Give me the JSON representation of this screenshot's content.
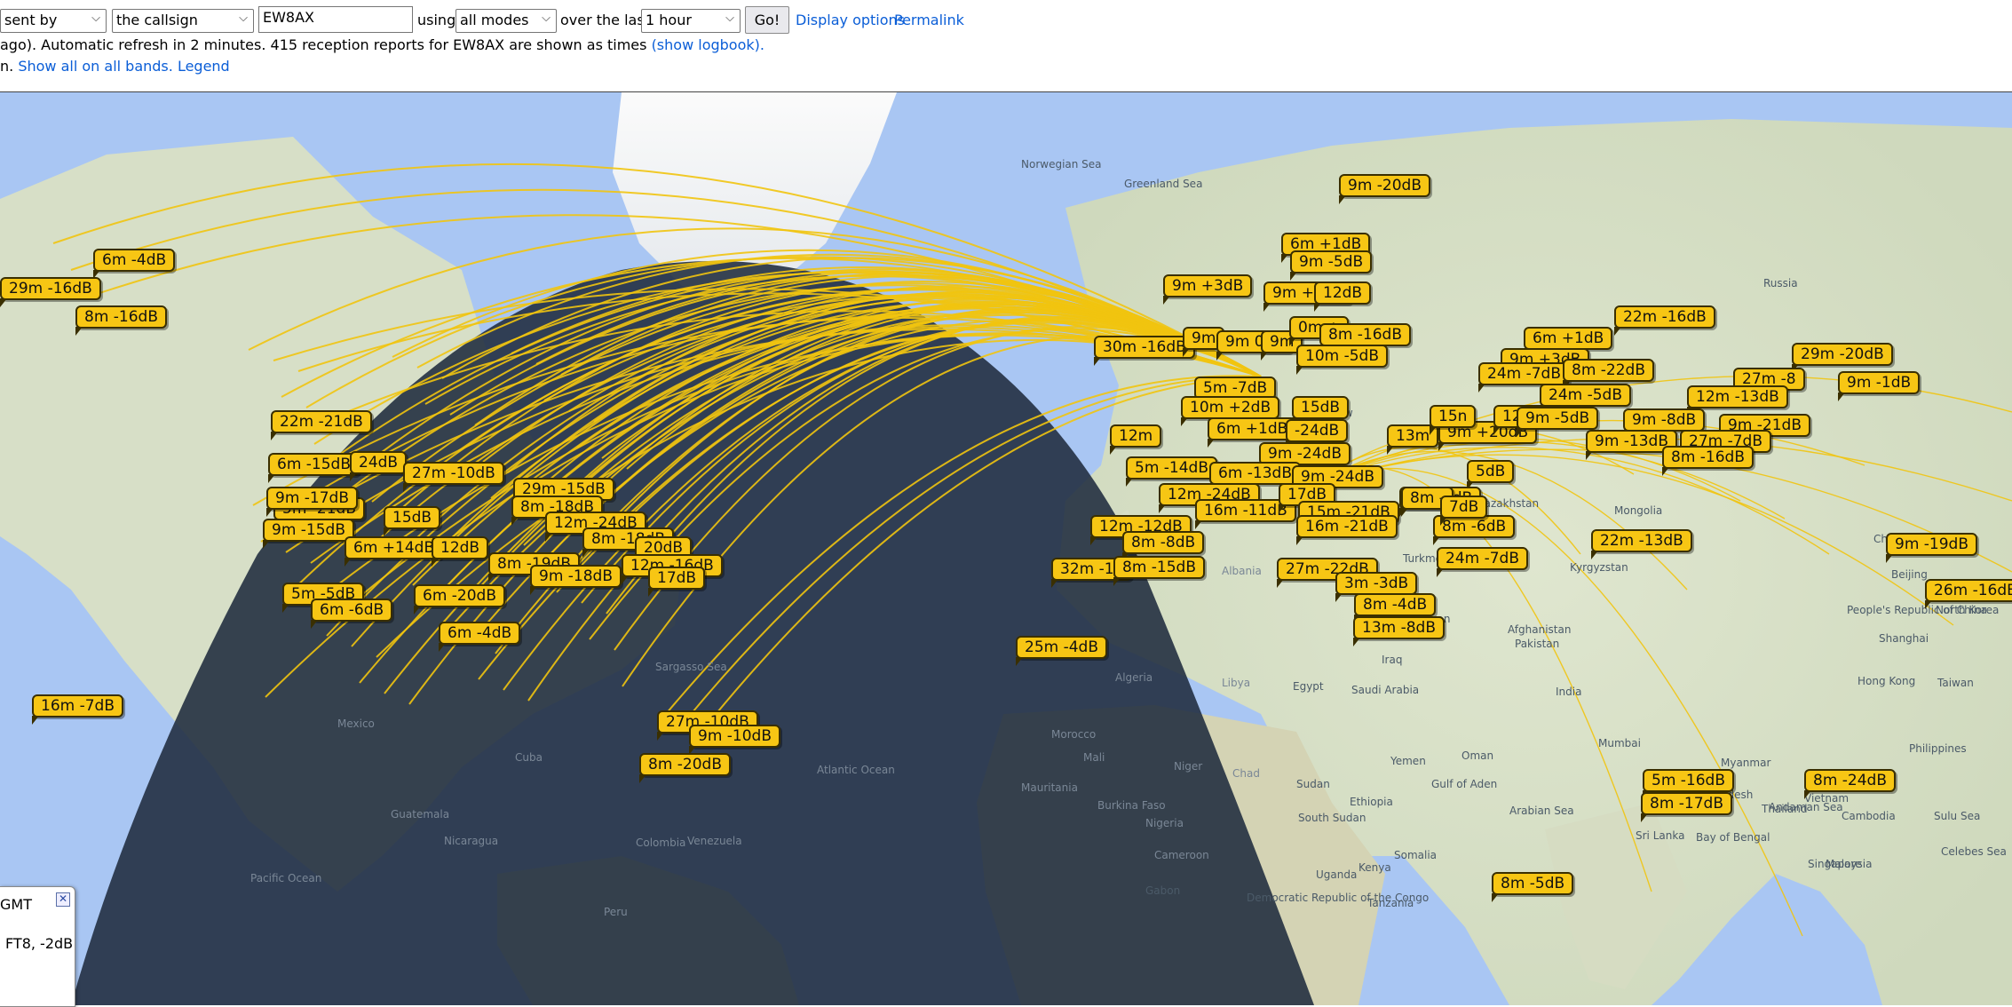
{
  "controls": {
    "sent_by": "sent by",
    "callsign_mode": "the callsign",
    "callsign_value": "EW8AX",
    "using_text": "using",
    "modes": "all modes",
    "over_text": "over the last",
    "period": "1 hour",
    "go_label": "Go!",
    "display_options": "Display options",
    "permalink": "Permalink"
  },
  "status": {
    "line2_text": "ago). Automatic refresh in 2 minutes. 415 reception reports for EW8AX are shown as times",
    "show_logbook": "(show logbook).",
    "line3_prefix": "n.",
    "show_all": "Show all on all bands.",
    "legend": "Legend"
  },
  "colors": {
    "label_fill": "#f7c614",
    "arc": "#f1c40f",
    "ocean": "#a9c6f3",
    "night": "#1f2b3e"
  },
  "map": {
    "labels": [
      "9m -20dB",
      "6m +1dB",
      "9m -5dB",
      "9m +7dB",
      "12dB",
      "9m +3dB",
      "6m -4dB",
      "29m -16dB",
      "8m -16dB",
      "22m -16dB",
      "30m -16dB",
      "9m",
      "9m 0dB",
      "9m",
      "0m +",
      "8m -16dB",
      "10m -5dB",
      "6m +1dB",
      "9m +3dB",
      "29m -20dB",
      "24m -7dB",
      "8m -22dB",
      "27m -8",
      "9m -1dB",
      "24m -5dB",
      "12m -13dB",
      "5m -7dB",
      "10m +2dB",
      "15dB",
      "22m -21dB",
      "6m +1dB",
      "-24dB",
      "9m -21dB",
      "13m",
      "9m +20dB",
      "15n",
      "12m -2",
      "9m -5dB",
      "9m -8dB",
      "9m -13dB",
      "27m -7dB",
      "8m -16dB",
      "12m",
      "9m -24dB",
      "5m -14dB",
      "6m -13dB",
      "9m -24dB",
      "5dB",
      "6m -15dB",
      "24dB",
      "27m -10dB",
      "29m -15dB",
      "8m -18dB",
      "5m -21dB",
      "9m -17dB",
      "15dB",
      "12m -24dB",
      "9m -15dB",
      "8m -18dB",
      "20dB",
      "6m +14dB",
      "12dB",
      "8m -19dB",
      "9m -18dB",
      "12m -16dB",
      "17dB",
      "6m -20dB",
      "5m -5dB",
      "6m -6dB",
      "6m -4dB",
      "12m -24dB",
      "16m -11dB",
      "12m -12dB",
      "8m -8dB",
      "32m -14",
      "8m -15dB",
      "27m -22dB",
      "3m -3dB",
      "17dB",
      "15m -21dB",
      "16m -21dB",
      "8m -6dB",
      "8m -6dB",
      "24m -7dB",
      "8m -4dB",
      "13m -8dB",
      "22m -13dB",
      "25m -4dB",
      "9m -19dB",
      "26m -16dB",
      "16m -7dB",
      "27m -10dB",
      "9m -10dB",
      "8m -20dB",
      "5m -16dB",
      "8m -17dB",
      "8m -24dB",
      "8m -5dB",
      "8m -",
      "7dB"
    ],
    "places": [
      "Russia",
      "Kazakhstan",
      "Mongolia",
      "China",
      "People's Republic of China",
      "Beijing",
      "North Korea",
      "Shanghai",
      "Hong Kong",
      "Taiwan",
      "Kyrgyzstan",
      "Afghanistan",
      "Pakistan",
      "Iran",
      "Iraq",
      "Saudi Arabia",
      "Egypt",
      "Libya",
      "Algeria",
      "Morocco",
      "Mali",
      "Niger",
      "Chad",
      "Sudan",
      "South Sudan",
      "Ethiopia",
      "Kenya",
      "Yemen",
      "Oman",
      "India",
      "Myanmar",
      "Thailand",
      "Vietnam",
      "Malaysia",
      "Singapore",
      "Bangladesh",
      "Sri Lanka",
      "Mumbai",
      "Gulf of Aden",
      "Arabian Sea",
      "Bay of Bengal",
      "Andaman Sea",
      "Sulu Sea",
      "Celebes Sea",
      "Norwegian Sea",
      "Greenland Sea",
      "Moscow",
      "Turkmenistan",
      "Sargasso Sea",
      "Atlantic Ocean",
      "Pacific Ocean",
      "Venezuela",
      "Colombia",
      "Peru",
      "Mexico",
      "Guatemala",
      "Nicaragua",
      "Cuba",
      "Mauritania",
      "Burkina Faso",
      "Nigeria",
      "Cameroon",
      "Gabon",
      "Democratic Republic of the Congo",
      "Uganda",
      "Albania",
      "Somalia",
      "Tanzania",
      "Philippines",
      "Cambodia"
    ]
  },
  "info_panel": {
    "line1": "GMT",
    "line2": "FT8, -2dB",
    "close": "✕"
  }
}
